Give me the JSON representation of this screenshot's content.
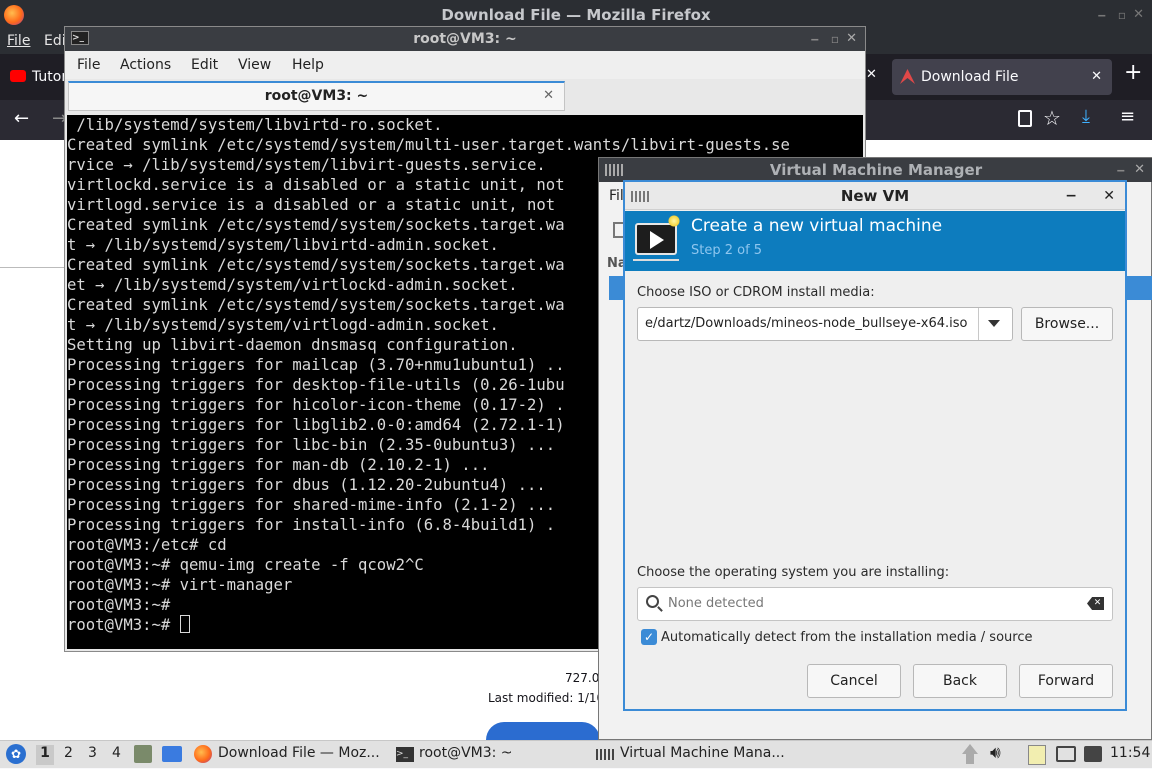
{
  "firefox": {
    "window_title": "Download File — Mozilla Firefox",
    "menu": [
      "File",
      "Edi"
    ],
    "tabs": [
      {
        "label": "Tutor"
      },
      {
        "label": "Download File"
      }
    ],
    "content": {
      "size_text": "727.0",
      "modified_text": "Last modified: 1/10"
    }
  },
  "terminal": {
    "window_title": "root@VM3: ~",
    "menu": [
      "File",
      "Actions",
      "Edit",
      "View",
      "Help"
    ],
    "tab_label": "root@VM3: ~",
    "lines": [
      " /lib/systemd/system/libvirtd-ro.socket.",
      "Created symlink /etc/systemd/system/multi-user.target.wants/libvirt-guests.se",
      "rvice → /lib/systemd/system/libvirt-guests.service.",
      "virtlockd.service is a disabled or a static unit, not",
      "virtlogd.service is a disabled or a static unit, not",
      "Created symlink /etc/systemd/system/sockets.target.wa",
      "t → /lib/systemd/system/libvirtd-admin.socket.",
      "Created symlink /etc/systemd/system/sockets.target.wa",
      "et → /lib/systemd/system/virtlockd-admin.socket.",
      "Created symlink /etc/systemd/system/sockets.target.wa",
      "t → /lib/systemd/system/virtlogd-admin.socket.",
      "Setting up libvirt-daemon dnsmasq configuration.",
      "Processing triggers for mailcap (3.70+nmu1ubuntu1) ..",
      "Processing triggers for desktop-file-utils (0.26-1ubu",
      "Processing triggers for hicolor-icon-theme (0.17-2) .",
      "Processing triggers for libglib2.0-0:amd64 (2.72.1-1)",
      "Processing triggers for libc-bin (2.35-0ubuntu3) ...",
      "Processing triggers for man-db (2.10.2-1) ...",
      "Processing triggers for dbus (1.12.20-2ubuntu4) ...",
      "Processing triggers for shared-mime-info (2.1-2) ...",
      "Processing triggers for install-info (6.8-4build1) .",
      "root@VM3:/etc# cd",
      "root@VM3:~# qemu-img create -f qcow2^C",
      "root@VM3:~# virt-manager",
      "root@VM3:~#"
    ],
    "prompt_last": "root@VM3:~# "
  },
  "vmm": {
    "window_title": "Virtual Machine Manager",
    "menu_first": "Fil",
    "column_header": "Na"
  },
  "newvm": {
    "window_title": "New VM",
    "header_title": "Create a new virtual machine",
    "header_step": "Step 2 of 5",
    "media_label": "Choose ISO or CDROM install media:",
    "media_value": "e/dartz/Downloads/mineos-node_bullseye-x64.iso",
    "browse_label": "Browse...",
    "os_label": "Choose the operating system you are installing:",
    "os_placeholder": "None detected",
    "autodetect_label": "Automatically detect from the installation media / source",
    "autodetect_checked": true,
    "cancel_label": "Cancel",
    "back_label": "Back",
    "forward_label": "Forward"
  },
  "taskbar": {
    "workspaces": [
      "1",
      "2",
      "3",
      "4"
    ],
    "tasks": [
      {
        "label": "Download File — Moz..."
      },
      {
        "label": "root@VM3: ~"
      },
      {
        "label": "Virtual Machine Mana..."
      }
    ],
    "clock": "11:54"
  },
  "colors": {
    "accent_blue": "#0d7cbe",
    "focus_blue": "#3b8bd6",
    "terminal_bg": "#000000"
  }
}
